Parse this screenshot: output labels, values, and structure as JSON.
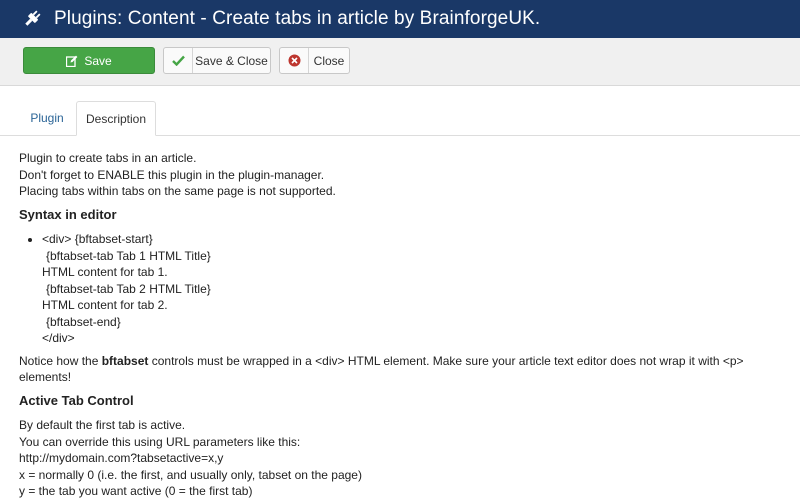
{
  "header": {
    "title": "Plugins: Content - Create tabs in article by BrainforgeUK."
  },
  "toolbar": {
    "save_label": "Save",
    "save_close_label": "Save & Close",
    "close_label": "Close"
  },
  "tabs": [
    {
      "label": "Plugin",
      "active": false
    },
    {
      "label": "Description",
      "active": true
    }
  ],
  "description": {
    "intro": [
      "Plugin to create tabs in an article.",
      "Don't forget to ENABLE this plugin in the plugin-manager.",
      "Placing tabs within tabs on the same page is not supported."
    ],
    "syntax_heading": "Syntax in editor",
    "syntax_lines": [
      "<div>  {bftabset-start}",
      " {bftabset-tab Tab 1 HTML Title}",
      "HTML content for tab 1.",
      " {bftabset-tab Tab 2 HTML Title}",
      "HTML content for tab 2.",
      " {bftabset-end}",
      "</div>"
    ],
    "notice_pre": "Notice how the ",
    "notice_bold": "bftabset",
    "notice_post": " controls must be wrapped in a <div> HTML element. Make sure your article text editor does not wrap it with <p> elements!",
    "active_heading": "Active Tab Control",
    "active_lines": [
      "By default the first tab is active.",
      "You can override this using URL parameters like this:",
      "http://mydomain.com?tabsetactive=x,y",
      "x = normally 0 (i.e. the first, and usually only, tabset on the page)",
      "y = the tab you want active (0 = the first tab)"
    ]
  },
  "icons": {
    "header": "plug-icon",
    "save": "edit-icon",
    "save_close": "check-icon",
    "close": "cancel-circle-icon"
  },
  "colors": {
    "header_bg": "#1a3867",
    "save_bg": "#46a546",
    "tab_link": "#2a6496",
    "close_icon": "#bd362f",
    "check_icon": "#46a546"
  }
}
